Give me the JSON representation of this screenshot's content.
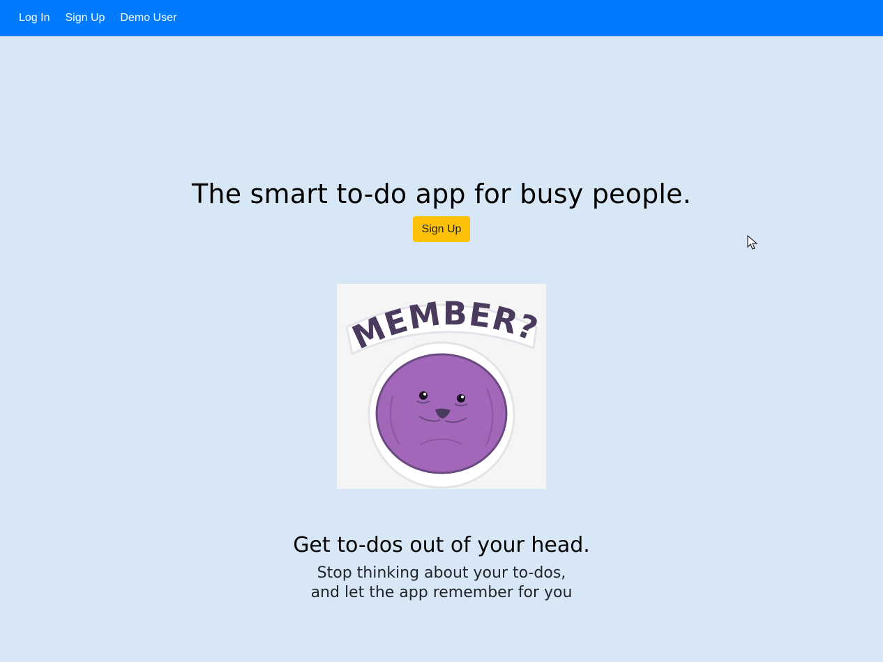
{
  "nav": {
    "login_label": "Log In",
    "signup_label": "Sign Up",
    "demo_label": "Demo User"
  },
  "hero": {
    "title": "The smart to-do app for busy people.",
    "signup_button_label": "Sign Up"
  },
  "illustration": {
    "caption_text": "MEMBER?",
    "icon": "purple-berry-character"
  },
  "feature": {
    "heading": "Get to-dos out of your head.",
    "line1": "Stop thinking about your to-dos,",
    "line2": "and let the app remember for you"
  },
  "colors": {
    "navbar": "#007bff",
    "background": "#d7e7f6",
    "button": "#ffc107",
    "character": "#a267b8",
    "lettering": "#4a3a5e"
  }
}
